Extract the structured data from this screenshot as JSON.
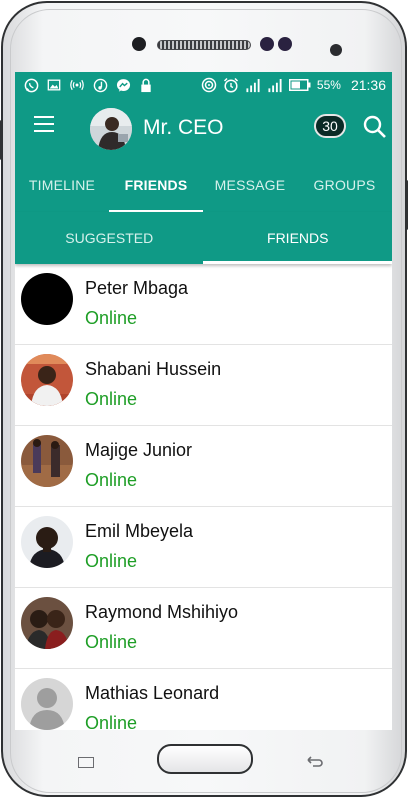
{
  "status_bar": {
    "battery": "55%",
    "time": "21:36",
    "left_icons": [
      "whatsapp-icon",
      "image-icon",
      "hotspot-icon",
      "music-icon",
      "messenger-icon",
      "lock-icon"
    ],
    "right_icons": [
      "cast-icon",
      "alarm-icon",
      "signal-icon",
      "signal-4g-icon",
      "battery-icon"
    ]
  },
  "app_bar": {
    "title": "Mr. CEO",
    "notification_count": "30"
  },
  "tabs": [
    {
      "label": "TIMELINE",
      "active": false
    },
    {
      "label": "FRIENDS",
      "active": true
    },
    {
      "label": "MESSAGE",
      "active": false
    },
    {
      "label": "GROUPS",
      "active": false
    }
  ],
  "subtabs": [
    {
      "label": "SUGGESTED",
      "active": false
    },
    {
      "label": "FRIENDS",
      "active": true
    }
  ],
  "friends": [
    {
      "name": "Peter Mbaga",
      "status": "Online"
    },
    {
      "name": "Shabani Hussein",
      "status": "Online"
    },
    {
      "name": "Majige Junior",
      "status": "Online"
    },
    {
      "name": "Emil Mbeyela",
      "status": "Online"
    },
    {
      "name": "Raymond Mshihiyo",
      "status": "Online"
    },
    {
      "name": "Mathias Leonard",
      "status": "Online"
    }
  ],
  "colors": {
    "primary": "#0f9a86",
    "online": "#1e9e26"
  }
}
